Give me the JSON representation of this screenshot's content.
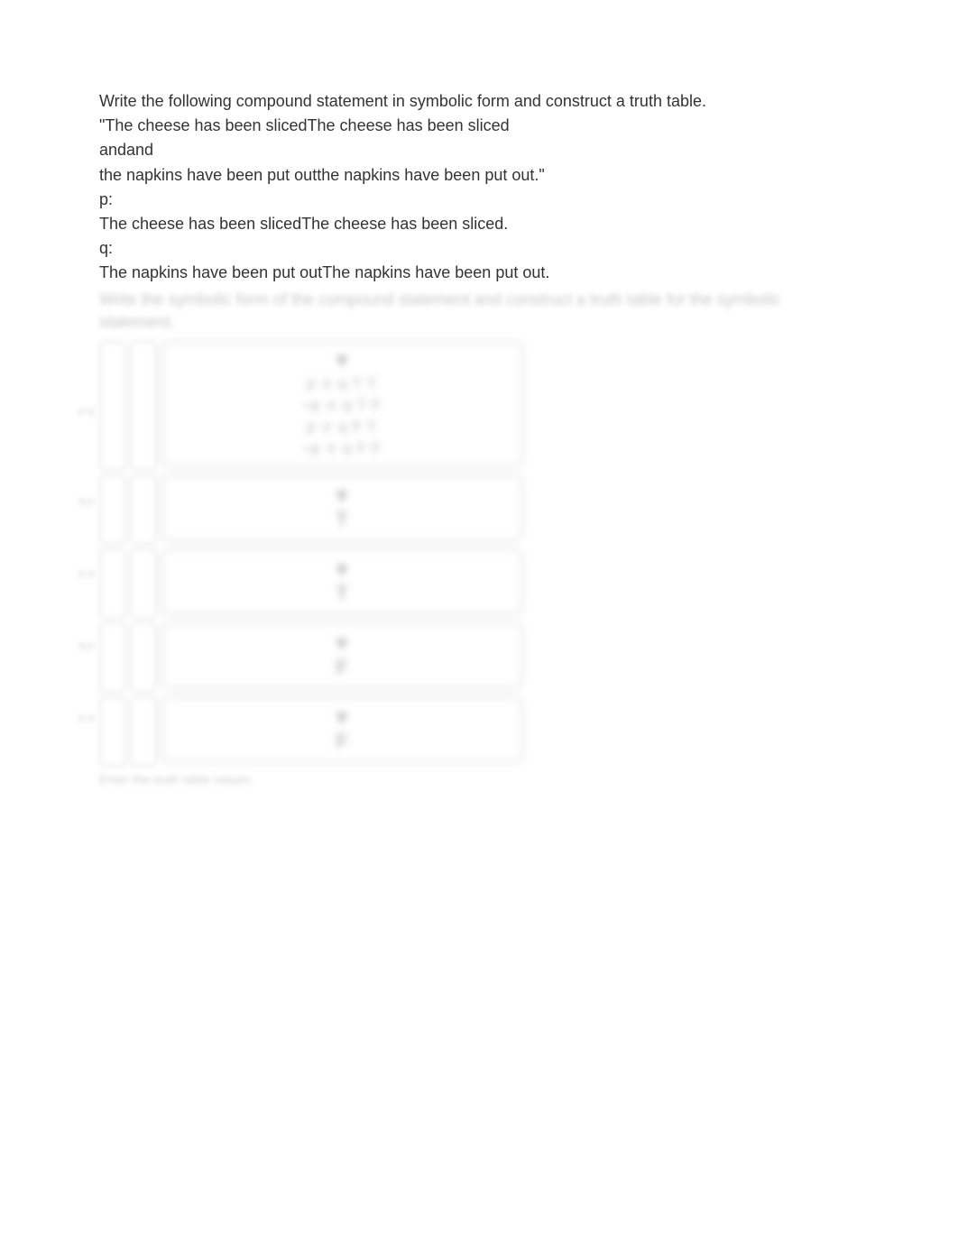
{
  "problem": {
    "intro": "Write the following compound statement in symbolic form and construct a truth table.",
    "quote_line1": "\"The cheese has been slicedThe cheese has been sliced",
    "quote_line2": "andand",
    "quote_line3": "the napkins have been put outthe napkins have been put out.\"",
    "p_label": "p:",
    "p_text": "The cheese has been slicedThe cheese has been sliced.",
    "q_label": "q:",
    "q_text": "The napkins have been put outThe napkins have been put out."
  },
  "blurred_instruction": "Write the symbolic form of the compound statement and construct a truth table for the symbolic statement.",
  "side_labels": [
    "p  q",
    "q  p",
    "p  q",
    "q  p",
    "p  q"
  ],
  "option_block": {
    "header": "▼",
    "lines": [
      "p ∧ q      T T",
      "¬p ∧ q     T F",
      "p ∨ q      F T",
      "¬p ∨ q     F F"
    ]
  },
  "small_cells": [
    {
      "top": "▼",
      "bottom": "T"
    },
    {
      "top": "▼",
      "bottom": "T"
    },
    {
      "top": "▼",
      "bottom": "F"
    },
    {
      "top": "▼",
      "bottom": "F"
    }
  ],
  "footer": "Enter the truth table values."
}
